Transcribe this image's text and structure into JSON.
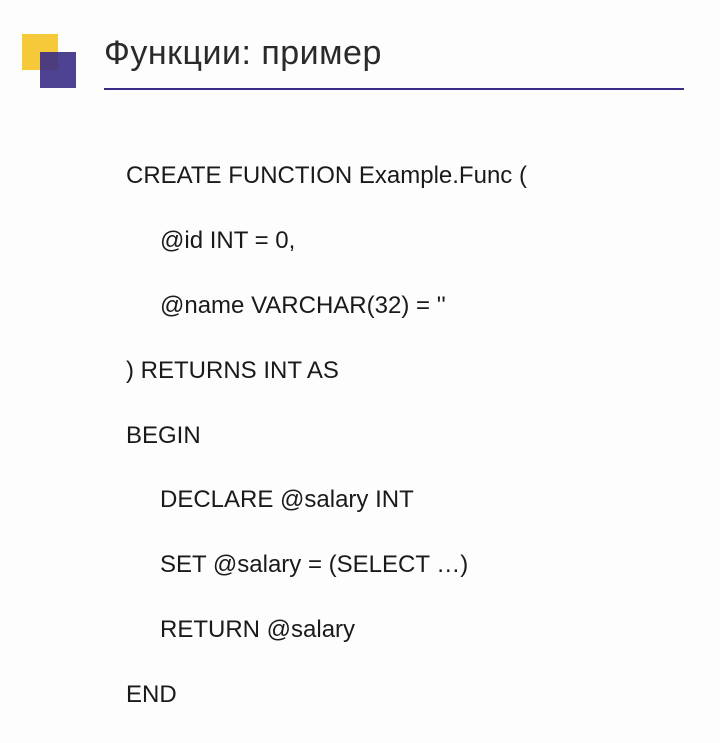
{
  "slide": {
    "title": "Функции: пример"
  },
  "code": {
    "l1": "CREATE FUNCTION Example.Func (",
    "l2": "@id INT = 0,",
    "l3": "@name VARCHAR(32) = ''",
    "l4": ") RETURNS INT AS",
    "l5": "BEGIN",
    "l6": "DECLARE @salary INT",
    "l7": "SET @salary = (SELECT …)",
    "l8": "RETURN @salary",
    "l9": "END"
  }
}
